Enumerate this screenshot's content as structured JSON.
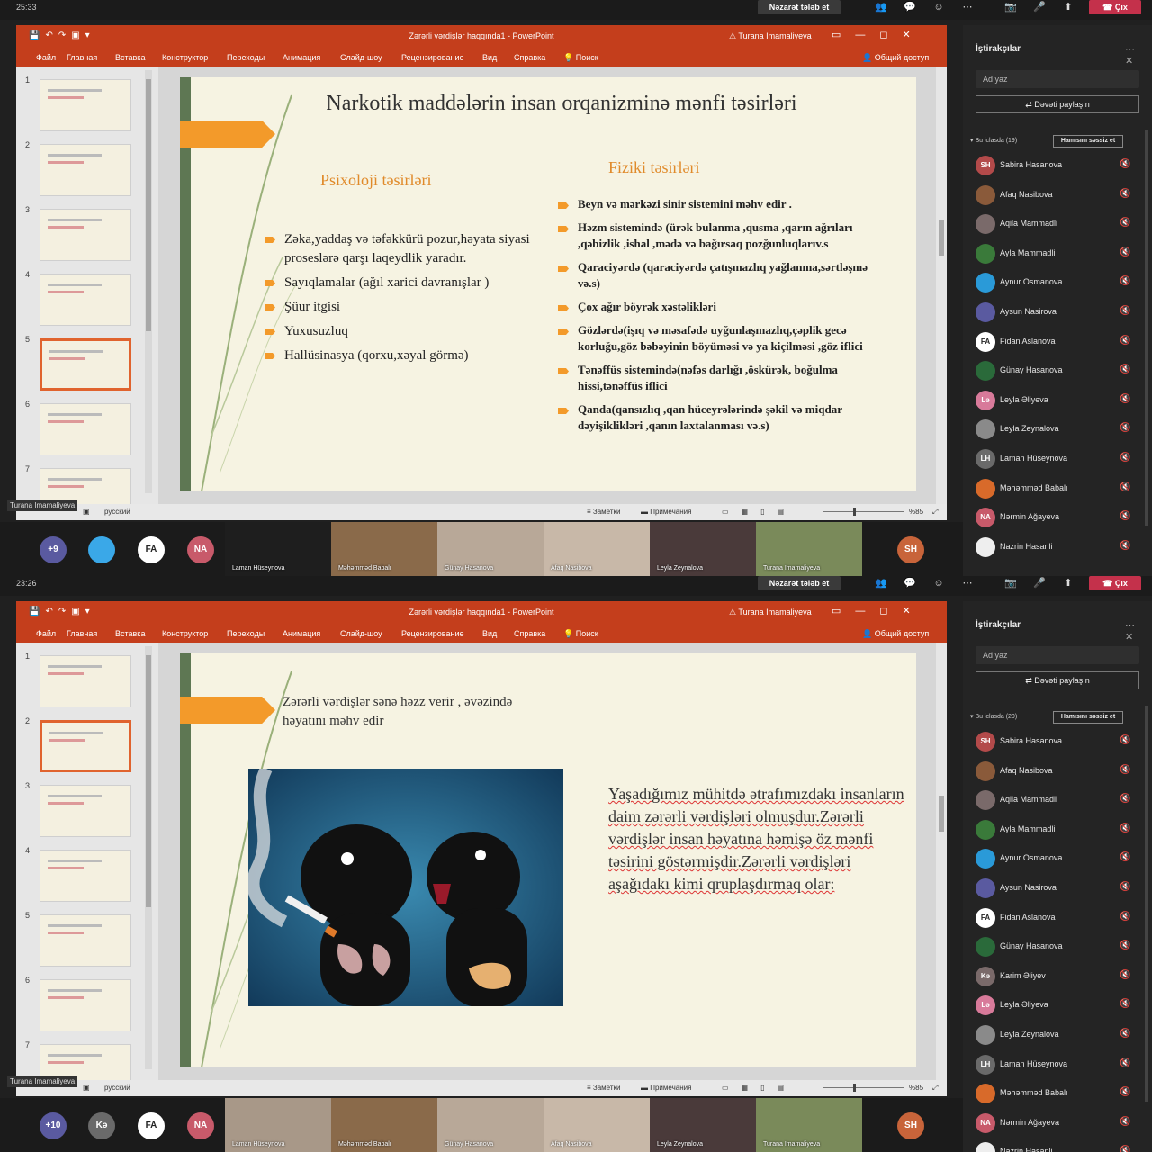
{
  "doc_title": "Zərərli vərdişlər haqqında1 - PowerPoint",
  "account": "Turana Imamaliyeva",
  "menu": [
    "Файл",
    "Главная",
    "Вставка",
    "Конструктор",
    "Переходы",
    "Анимация",
    "Слайд-шоу",
    "Рецензирование",
    "Вид",
    "Справка",
    "Поиск"
  ],
  "share": "Общий доступ",
  "request_control": "Nəzarət tələb et",
  "leave": "Çıx",
  "panel_title": "İştirakçılar",
  "search_placeholder": "Ad yaz",
  "invite": "Dəvəti paylaşın",
  "mute_all": "Hamısını səssiz et",
  "status_notes": "Заметки",
  "status_comments": "Примечания",
  "language": "русский",
  "zoom": "%85",
  "top": {
    "time": "25:33",
    "selected_slide": 5,
    "incall": "Bu iclasda (19)",
    "participants": [
      {
        "i": "SH",
        "n": "Sabira Hasanova",
        "c": "#b34a4a"
      },
      {
        "i": "",
        "n": "Afaq Nasibova",
        "c": "#8a5a3a"
      },
      {
        "i": "",
        "n": "Aqila Mammadli",
        "c": "#7a6a6a"
      },
      {
        "i": "",
        "n": "Ayla Mammadli",
        "c": "#3a7a3a"
      },
      {
        "i": "",
        "n": "Aynur Osmanova",
        "c": "#2a9ad8"
      },
      {
        "i": "",
        "n": "Aysun Nasirova",
        "c": "#5a5aa0"
      },
      {
        "i": "FA",
        "n": "Fidan Aslanova",
        "c": "#ffffff"
      },
      {
        "i": "",
        "n": "Günay Hasanova",
        "c": "#2a6a3a"
      },
      {
        "i": "Lə",
        "n": "Leyla Əliyeva",
        "c": "#d87a9a"
      },
      {
        "i": "",
        "n": "Leyla Zeynalova",
        "c": "#8a8a8a"
      },
      {
        "i": "LH",
        "n": "Laman Hüseynova",
        "c": "#6a6a6a"
      },
      {
        "i": "",
        "n": "Məhəmməd Babalı",
        "c": "#d86a2a"
      },
      {
        "i": "NA",
        "n": "Nərmin Ağayeva",
        "c": "#c85a6a"
      },
      {
        "i": "",
        "n": "Nazrin Hasanli",
        "c": "#eeeeee"
      }
    ],
    "strip": {
      "count": "+9",
      "bubbles": [
        {
          "i": "",
          "c": "#3aa8e8"
        },
        {
          "i": "FA",
          "c": "#ffffff"
        },
        {
          "i": "NA",
          "c": "#c85a6a"
        }
      ],
      "tiles": [
        {
          "n": "Laman Hüseynova",
          "v": "#1e1e1e"
        },
        {
          "n": "Məhəmməd Babalı",
          "v": "#8a6a4a"
        },
        {
          "n": "Günay Hasanova",
          "v": "#b8a898"
        },
        {
          "n": "Afaq Nasibova",
          "v": "#c8b8a8"
        },
        {
          "n": "Leyla Zeynalova",
          "v": "#4a3a3a"
        },
        {
          "n": "Turana Imamaliyeva",
          "v": "#7a8a5a"
        }
      ],
      "self": "SH"
    },
    "slide": {
      "title": "Narkotik maddələrin insan orqanizminə mənfi təsirləri",
      "left_title": "Psixoloji təsirləri",
      "left": [
        "Zəka,yaddaş və təfəkkürü pozur,həyata siyasi proseslərə qarşı laqeydlik yaradır.",
        "Sayıqlamalar (ağıl xarici davranışlar )",
        "Şüur itgisi",
        "Yuxusuzluq",
        "Hallüsinasya (qorxu,xəyal görmə)"
      ],
      "right_title": "Fiziki təsirləri",
      "right": [
        "Beyn və mərkəzi sinir sistemini məhv edir .",
        "Həzm sistemində (ürək bulanma ,qusma ,qarın ağrıları ,qəbizlik ,ishal ,mədə və bağırsaq pozğunluqlarıv.s",
        "Qaraciyərdə (qaraciyərdə çatışmazlıq yağlanma,sərtləşmə və.s)",
        "Çox ağır böyrək xəstəlikləri",
        "Gözlərdə(işıq və məsafədə uyğunlaşmazlıq,çəplik gecə korluğu,göz bəbəyinin böyüməsi və ya kiçilməsi ,göz iflici",
        "Tənəffüs sistemində(nəfəs darlığı ,öskürək, boğulma hissi,tənəffüs iflici",
        "Qanda(qansızlıq ,qan hüceyrələrində şəkil və miqdar dəyişiklikləri ,qanın laxtalanması və.s)"
      ]
    }
  },
  "bottom": {
    "time": "23:26",
    "selected_slide": 2,
    "incall": "Bu iclasda (20)",
    "participants": [
      {
        "i": "SH",
        "n": "Sabira Hasanova",
        "c": "#b34a4a"
      },
      {
        "i": "",
        "n": "Afaq Nasibova",
        "c": "#8a5a3a"
      },
      {
        "i": "",
        "n": "Aqila Mammadli",
        "c": "#7a6a6a"
      },
      {
        "i": "",
        "n": "Ayla Mammadli",
        "c": "#3a7a3a"
      },
      {
        "i": "",
        "n": "Aynur Osmanova",
        "c": "#2a9ad8"
      },
      {
        "i": "",
        "n": "Aysun Nasirova",
        "c": "#5a5aa0"
      },
      {
        "i": "FA",
        "n": "Fidan Aslanova",
        "c": "#ffffff"
      },
      {
        "i": "",
        "n": "Günay Hasanova",
        "c": "#2a6a3a"
      },
      {
        "i": "Kə",
        "n": "Karim Əliyev",
        "c": "#7a6a6a"
      },
      {
        "i": "Lə",
        "n": "Leyla Əliyeva",
        "c": "#d87a9a"
      },
      {
        "i": "",
        "n": "Leyla Zeynalova",
        "c": "#8a8a8a"
      },
      {
        "i": "LH",
        "n": "Laman Hüseynova",
        "c": "#6a6a6a"
      },
      {
        "i": "",
        "n": "Məhəmməd Babalı",
        "c": "#d86a2a"
      },
      {
        "i": "NA",
        "n": "Nərmin Ağayeva",
        "c": "#c85a6a"
      },
      {
        "i": "",
        "n": "Nazrin Hasanli",
        "c": "#eeeeee"
      }
    ],
    "strip": {
      "count": "+10",
      "bubbles": [
        {
          "i": "Kə",
          "c": "#6a6a6a"
        },
        {
          "i": "FA",
          "c": "#ffffff"
        },
        {
          "i": "NA",
          "c": "#c85a6a"
        }
      ],
      "tiles": [
        {
          "n": "Laman Hüseynova",
          "v": "#a89888"
        },
        {
          "n": "Məhəmməd Babalı",
          "v": "#8a6a4a"
        },
        {
          "n": "Günay Hasanova",
          "v": "#b8a898"
        },
        {
          "n": "Afaq Nasibova",
          "v": "#c8b8a8"
        },
        {
          "n": "Leyla Zeynalova",
          "v": "#4a3a3a"
        },
        {
          "n": "Turana Imamaliyeva",
          "v": "#7a8a5a"
        }
      ],
      "self": "SH"
    },
    "slide": {
      "heading": "Zərərli vərdişlər sənə həzz verir , əvəzində həyatını məhv edir",
      "paragraph": "Yaşadığımız mühitdə ətrafımızdakı insanların daim zərərli vərdişləri olmuşdur.Zərərli vərdişlər insan həyatına həmişə öz mənfi təsirini göstərmişdir.Zərərli vərdişləri aşağıdakı kimi qruplaşdırmaq olar:"
    }
  }
}
